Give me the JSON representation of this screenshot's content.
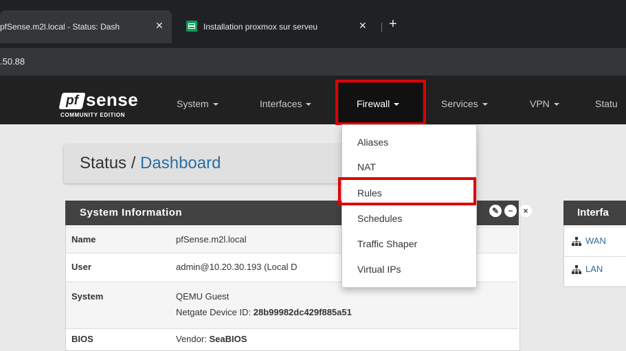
{
  "browser": {
    "tabs": [
      {
        "title": "pfSense.m2l.local - Status: Dash"
      },
      {
        "title": "Installation proxmox sur serveu"
      }
    ],
    "address": ".50.88"
  },
  "logo": {
    "word": "sense",
    "mark": "pf",
    "edition": "COMMUNITY EDITION"
  },
  "nav": {
    "items": [
      "System",
      "Interfaces",
      "Firewall",
      "Services",
      "VPN",
      "Statu"
    ]
  },
  "firewall_menu": {
    "items": [
      "Aliases",
      "NAT",
      "Rules",
      "Schedules",
      "Traffic Shaper",
      "Virtual IPs"
    ]
  },
  "breadcrumb": {
    "section": "Status /",
    "page": "Dashboard"
  },
  "system_info": {
    "title": "System Information",
    "rows": [
      {
        "key": "Name",
        "value": "pfSense.m2l.local"
      },
      {
        "key": "User",
        "value": "admin@10.20.30.193 (Local D"
      },
      {
        "key": "System",
        "value": "QEMU Guest",
        "extra_label": "Netgate Device ID:",
        "extra_value": "28b99982dc429f885a51"
      },
      {
        "key": "BIOS",
        "value_label": "Vendor:",
        "value": "SeaBIOS"
      }
    ]
  },
  "interfaces": {
    "title": "Interfa",
    "items": [
      "WAN",
      "LAN"
    ]
  },
  "colors": {
    "highlight": "#e00000",
    "navbar": "#212121",
    "link": "#2b6ea1"
  }
}
